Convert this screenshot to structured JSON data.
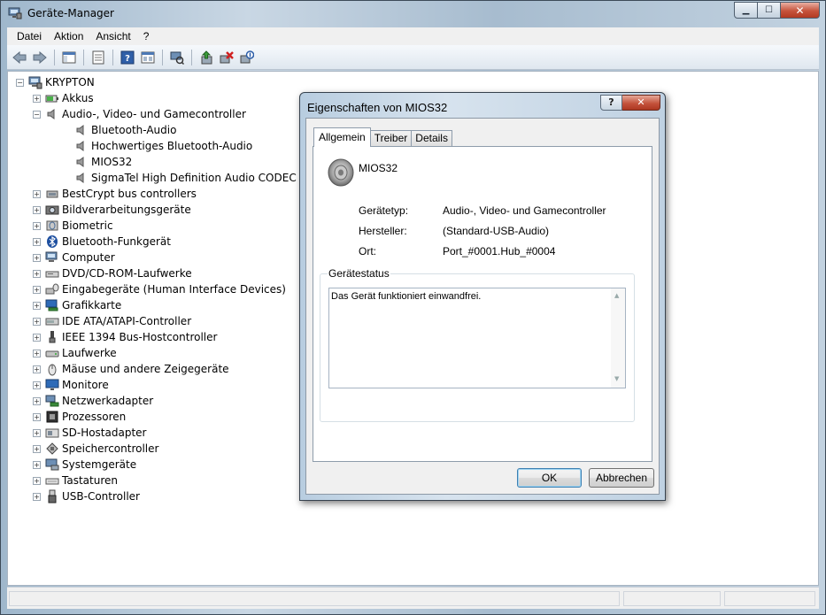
{
  "window": {
    "title": "Geräte-Manager",
    "controls": {
      "minimize": "▁",
      "maximize": "☐",
      "close": "✕"
    }
  },
  "menu": [
    "Datei",
    "Aktion",
    "Ansicht",
    "?"
  ],
  "toolbar_icons": [
    "back-arrow-icon",
    "forward-arrow-icon",
    "console-tree-icon",
    "properties-icon",
    "help-icon",
    "view-icon",
    "scan-hardware-icon",
    "update-driver-icon",
    "uninstall-icon",
    "disable-icon"
  ],
  "tree": {
    "root": "KRYPTON",
    "items": [
      {
        "label": "Akkus",
        "level": 1,
        "expander": "+",
        "icon": "battery-icon"
      },
      {
        "label": "Audio-, Video- und Gamecontroller",
        "level": 1,
        "expander": "−",
        "icon": "speaker-icon"
      },
      {
        "label": "Bluetooth-Audio",
        "level": 2,
        "icon": "speaker-icon"
      },
      {
        "label": "Hochwertiges Bluetooth-Audio",
        "level": 2,
        "icon": "speaker-icon"
      },
      {
        "label": "MIOS32",
        "level": 2,
        "icon": "speaker-icon"
      },
      {
        "label": "SigmaTel High Definition Audio CODEC",
        "level": 2,
        "icon": "speaker-icon"
      },
      {
        "label": "BestCrypt bus controllers",
        "level": 1,
        "expander": "+",
        "icon": "controller-icon"
      },
      {
        "label": "Bildverarbeitungsgeräte",
        "level": 1,
        "expander": "+",
        "icon": "camera-icon"
      },
      {
        "label": "Biometric",
        "level": 1,
        "expander": "+",
        "icon": "biometric-icon"
      },
      {
        "label": "Bluetooth-Funkgerät",
        "level": 1,
        "expander": "+",
        "icon": "bluetooth-icon"
      },
      {
        "label": "Computer",
        "level": 1,
        "expander": "+",
        "icon": "computer-icon"
      },
      {
        "label": "DVD/CD-ROM-Laufwerke",
        "level": 1,
        "expander": "+",
        "icon": "dvd-icon"
      },
      {
        "label": "Eingabegeräte (Human Interface Devices)",
        "level": 1,
        "expander": "+",
        "icon": "hid-icon"
      },
      {
        "label": "Grafikkarte",
        "level": 1,
        "expander": "+",
        "icon": "display-adapter-icon"
      },
      {
        "label": "IDE ATA/ATAPI-Controller",
        "level": 1,
        "expander": "+",
        "icon": "ide-icon"
      },
      {
        "label": "IEEE 1394 Bus-Hostcontroller",
        "level": 1,
        "expander": "+",
        "icon": "firewire-icon"
      },
      {
        "label": "Laufwerke",
        "level": 1,
        "expander": "+",
        "icon": "drive-icon"
      },
      {
        "label": "Mäuse und andere Zeigegeräte",
        "level": 1,
        "expander": "+",
        "icon": "mouse-icon"
      },
      {
        "label": "Monitore",
        "level": 1,
        "expander": "+",
        "icon": "monitor-icon"
      },
      {
        "label": "Netzwerkadapter",
        "level": 1,
        "expander": "+",
        "icon": "network-icon"
      },
      {
        "label": "Prozessoren",
        "level": 1,
        "expander": "+",
        "icon": "processor-icon"
      },
      {
        "label": "SD-Hostadapter",
        "level": 1,
        "expander": "+",
        "icon": "sd-icon"
      },
      {
        "label": "Speichercontroller",
        "level": 1,
        "expander": "+",
        "icon": "storage-icon"
      },
      {
        "label": "Systemgeräte",
        "level": 1,
        "expander": "+",
        "icon": "system-icon"
      },
      {
        "label": "Tastaturen",
        "level": 1,
        "expander": "+",
        "icon": "keyboard-icon"
      },
      {
        "label": "USB-Controller",
        "level": 1,
        "expander": "+",
        "icon": "usb-icon"
      }
    ]
  },
  "dialog": {
    "title": "Eigenschaften von MIOS32",
    "help": "?",
    "close": "✕",
    "tabs": [
      {
        "label": "Allgemein",
        "active": true
      },
      {
        "label": "Treiber",
        "active": false
      },
      {
        "label": "Details",
        "active": false
      }
    ],
    "device_name": "MIOS32",
    "props": [
      {
        "label": "Gerätetyp:",
        "value": "Audio-, Video- und Gamecontroller"
      },
      {
        "label": "Hersteller:",
        "value": "(Standard-USB-Audio)"
      },
      {
        "label": "Ort:",
        "value": "Port_#0001.Hub_#0004"
      }
    ],
    "status_group": "Gerätestatus",
    "status_text": "Das Gerät funktioniert einwandfrei.",
    "ok": "OK",
    "cancel": "Abbrechen"
  }
}
